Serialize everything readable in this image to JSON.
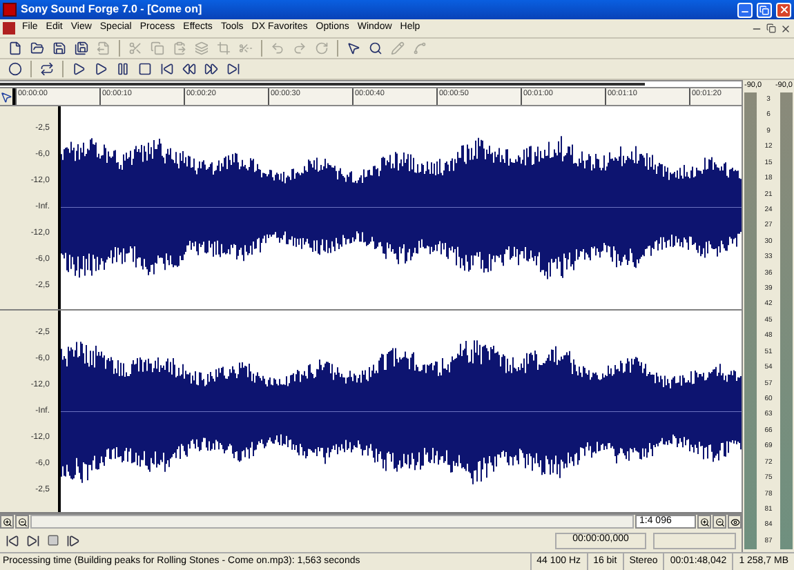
{
  "window": {
    "title": "Sony Sound Forge 7.0 - [Come on]"
  },
  "menu": [
    "File",
    "Edit",
    "View",
    "Special",
    "Process",
    "Effects",
    "Tools",
    "DX Favorites",
    "Options",
    "Window",
    "Help"
  ],
  "toolbar_1": [
    {
      "kind": "new",
      "disabled": false
    },
    {
      "kind": "open",
      "disabled": false
    },
    {
      "kind": "save",
      "disabled": false
    },
    {
      "kind": "save-as",
      "disabled": false
    },
    {
      "kind": "render",
      "disabled": true
    },
    {
      "kind": "sep"
    },
    {
      "kind": "cut",
      "disabled": true
    },
    {
      "kind": "copy",
      "disabled": true
    },
    {
      "kind": "paste",
      "disabled": true
    },
    {
      "kind": "mix",
      "disabled": true
    },
    {
      "kind": "crop",
      "disabled": true
    },
    {
      "kind": "trim",
      "disabled": true
    },
    {
      "kind": "sep"
    },
    {
      "kind": "undo",
      "disabled": true
    },
    {
      "kind": "redo",
      "disabled": true
    },
    {
      "kind": "repeat",
      "disabled": true
    },
    {
      "kind": "sep"
    },
    {
      "kind": "edit-tool",
      "disabled": false
    },
    {
      "kind": "magnify",
      "disabled": false
    },
    {
      "kind": "pencil",
      "disabled": true
    },
    {
      "kind": "envelope",
      "disabled": true
    }
  ],
  "toolbar_2": [
    {
      "kind": "record",
      "disabled": false
    },
    {
      "kind": "sep"
    },
    {
      "kind": "loop",
      "disabled": false
    },
    {
      "kind": "sep"
    },
    {
      "kind": "play-all",
      "disabled": false
    },
    {
      "kind": "play",
      "disabled": false
    },
    {
      "kind": "pause",
      "disabled": false
    },
    {
      "kind": "stop",
      "disabled": false
    },
    {
      "kind": "go-start",
      "disabled": false
    },
    {
      "kind": "rewind",
      "disabled": false
    },
    {
      "kind": "forward",
      "disabled": false
    },
    {
      "kind": "go-end",
      "disabled": false
    }
  ],
  "overview": {
    "level": 0.87
  },
  "ruler": [
    "00:00:00",
    "00:00:10",
    "00:00:20",
    "00:00:30",
    "00:00:40",
    "00:00:50",
    "00:01:00",
    "00:01:10",
    "00:01:20"
  ],
  "channels": [
    {
      "scale": [
        "-2,5",
        "-6,0",
        "-12,0",
        "-Inf.",
        "-12,0",
        "-6,0",
        "-2,5"
      ]
    },
    {
      "scale": [
        "-2,5",
        "-6,0",
        "-12,0",
        "-Inf.",
        "-12,0",
        "-6,0",
        "-2,5"
      ]
    }
  ],
  "zoom_ratio": "1:4 096",
  "time_display": "00:00:00,000",
  "meters": {
    "readings": [
      "-90,0",
      "-90,0"
    ],
    "scale": [
      "3",
      "6",
      "9",
      "12",
      "15",
      "18",
      "21",
      "24",
      "27",
      "30",
      "33",
      "36",
      "39",
      "42",
      "45",
      "48",
      "51",
      "54",
      "57",
      "60",
      "63",
      "66",
      "69",
      "72",
      "75",
      "78",
      "81",
      "84",
      "87"
    ]
  },
  "status_bar": {
    "message": "Processing time (Building peaks for Rolling Stones - Come on.mp3): 1,563 seconds",
    "fields": [
      "44 100 Hz",
      "16 bit",
      "Stereo",
      "00:01:48,042",
      "1 258,7 MB"
    ]
  }
}
